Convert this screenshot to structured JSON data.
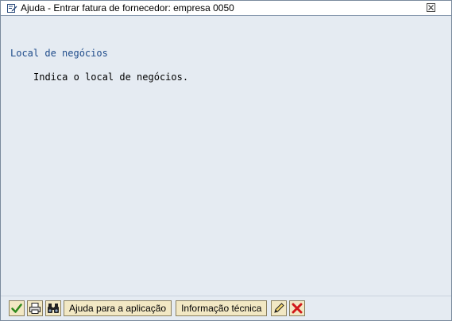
{
  "window": {
    "title": "Ajuda - Entrar fatura de fornecedor: empresa 0050",
    "title_icon": "document-edit-icon",
    "close_icon": "close-icon"
  },
  "content": {
    "heading": "Local de negócios",
    "body": "Indica o local de negócios."
  },
  "toolbar": {
    "buttons": [
      {
        "icon": "checkmark-icon"
      },
      {
        "icon": "printer-icon"
      },
      {
        "icon": "binoculars-icon"
      }
    ],
    "app_help_label": "Ajuda para a aplicação",
    "tech_info_label": "Informação técnica",
    "edit_icon": "pencil-icon",
    "cancel_icon": "cancel-x-icon"
  },
  "colors": {
    "heading": "#1e4b8a",
    "background": "#e5ebf2",
    "button_bg": "#f2e8c4",
    "check_green": "#2f8a1e",
    "cancel_red": "#d11a1a"
  }
}
